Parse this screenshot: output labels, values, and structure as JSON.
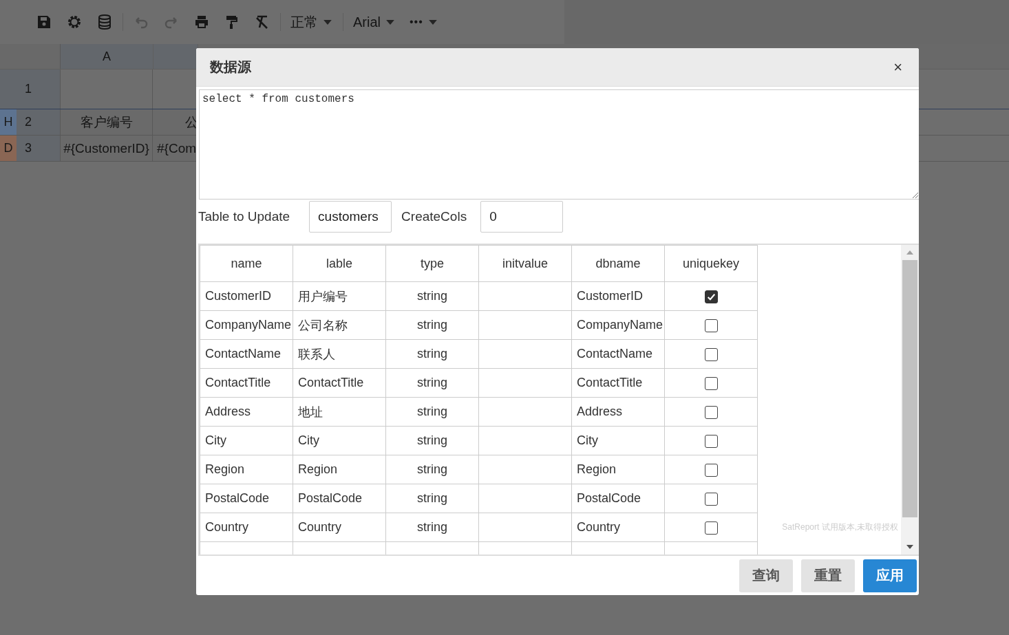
{
  "toolbar": {
    "undo": {
      "disabled": true
    },
    "redo": {
      "disabled": true
    },
    "style_select": "正常",
    "font_select": "Arial",
    "more": "•••"
  },
  "sheet": {
    "columns": [
      "A",
      ""
    ],
    "rows": [
      {
        "number": "1",
        "cells": [
          "",
          ""
        ]
      },
      {
        "number": "2",
        "marker": "H",
        "color": "#5d7390",
        "cells": [
          "客户编号",
          "公"
        ]
      },
      {
        "number": "3",
        "marker": "D",
        "color": "#8a6654",
        "cells": [
          "#{CustomerID}",
          "#{Com"
        ]
      }
    ]
  },
  "dialog": {
    "title": "数据源",
    "close": "×",
    "sql": "select * from customers",
    "table_to_update": {
      "label": "Table to Update",
      "value": "customers"
    },
    "create_cols": {
      "label": "CreateCols",
      "value": "0"
    },
    "grid": {
      "columns": [
        "name",
        "lable",
        "type",
        "initvalue",
        "dbname",
        "uniquekey"
      ],
      "rows": [
        {
          "name": "CustomerID",
          "lable": "用户编号",
          "type": "string",
          "initvalue": "",
          "dbname": "CustomerID",
          "uniquekey": true
        },
        {
          "name": "CompanyName",
          "lable": "公司名称",
          "type": "string",
          "initvalue": "",
          "dbname": "CompanyName",
          "uniquekey": false
        },
        {
          "name": "ContactName",
          "lable": "联系人",
          "type": "string",
          "initvalue": "",
          "dbname": "ContactName",
          "uniquekey": false
        },
        {
          "name": "ContactTitle",
          "lable": "ContactTitle",
          "type": "string",
          "initvalue": "",
          "dbname": "ContactTitle",
          "uniquekey": false
        },
        {
          "name": "Address",
          "lable": "地址",
          "type": "string",
          "initvalue": "",
          "dbname": "Address",
          "uniquekey": false
        },
        {
          "name": "City",
          "lable": "City",
          "type": "string",
          "initvalue": "",
          "dbname": "City",
          "uniquekey": false
        },
        {
          "name": "Region",
          "lable": "Region",
          "type": "string",
          "initvalue": "",
          "dbname": "Region",
          "uniquekey": false
        },
        {
          "name": "PostalCode",
          "lable": "PostalCode",
          "type": "string",
          "initvalue": "",
          "dbname": "PostalCode",
          "uniquekey": false
        },
        {
          "name": "Country",
          "lable": "Country",
          "type": "string",
          "initvalue": "",
          "dbname": "Country",
          "uniquekey": false
        }
      ]
    },
    "watermark": "SatReport 试用版本,未取得授权",
    "buttons": [
      {
        "label": "查询",
        "kind": "default"
      },
      {
        "label": "重置",
        "kind": "default"
      },
      {
        "label": "应用",
        "kind": "primary"
      }
    ]
  }
}
